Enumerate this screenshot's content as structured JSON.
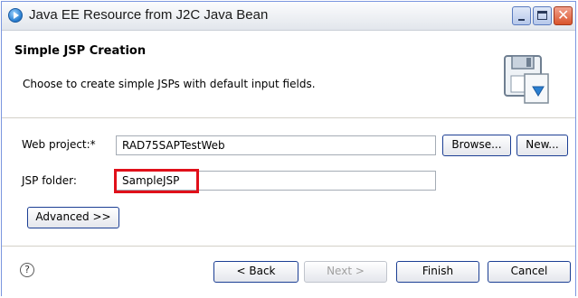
{
  "window": {
    "title": "Java EE Resource from J2C Java Bean"
  },
  "banner": {
    "title": "Simple JSP Creation",
    "description": "Choose to create simple JSPs with default input fields."
  },
  "form": {
    "web_project_label": "Web project:*",
    "web_project_value": "RAD75SAPTestWeb",
    "browse_label": "Browse...",
    "new_label": "New...",
    "jsp_folder_label": "JSP folder:",
    "jsp_folder_value": "SampleJSP",
    "advanced_label": "Advanced >>"
  },
  "footer": {
    "help_glyph": "?",
    "back_label": "< Back",
    "next_label": "Next >",
    "finish_label": "Finish",
    "cancel_label": "Cancel"
  },
  "colors": {
    "highlight": "#e0101a",
    "button_border": "#1c3f94"
  }
}
